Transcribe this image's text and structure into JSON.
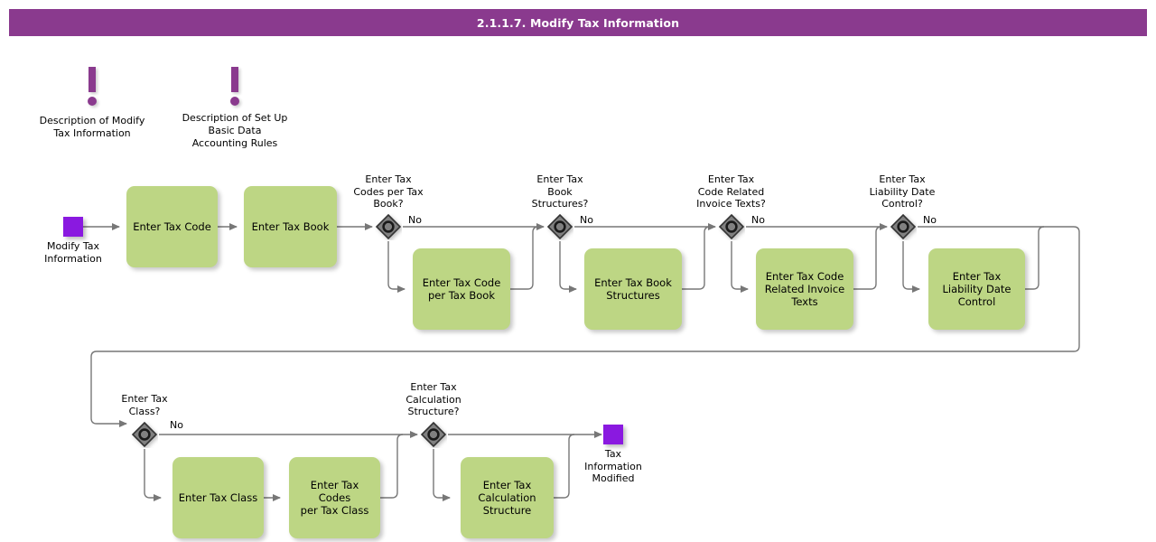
{
  "header": {
    "title": "2.1.1.7. Modify Tax Information",
    "background": "#8A3A8E",
    "text_color": "#FFFFFF"
  },
  "theme": {
    "task_fill": "#BDD684",
    "event_fill": "#8A19E0",
    "gateway_fill": "#808080",
    "gateway_stroke": "#333333",
    "connector_stroke": "#777777",
    "annotation_color": "#8A3A8E"
  },
  "annotations": [
    {
      "id": "annot-modify-tax-information",
      "icon": "exclamation-icon",
      "label": "Description of Modify\nTax Information"
    },
    {
      "id": "annot-basic-data-accounting-rules",
      "icon": "exclamation-icon",
      "label": "Description of Set Up\nBasic Data\nAccounting Rules"
    }
  ],
  "events": [
    {
      "id": "start-modify-tax-information",
      "type": "start",
      "label": "Modify Tax\nInformation"
    },
    {
      "id": "end-tax-information-modified",
      "type": "end",
      "label": "Tax\nInformation\nModified"
    }
  ],
  "gateways": [
    {
      "id": "gw-tax-codes-per-tax-book",
      "label": "Enter Tax\nCodes per Tax\nBook?",
      "flow_label": "No"
    },
    {
      "id": "gw-tax-book-structures",
      "label": "Enter Tax\nBook\nStructures?",
      "flow_label": "No"
    },
    {
      "id": "gw-tax-code-related-invoice-texts",
      "label": "Enter Tax\nCode Related\nInvoice Texts?",
      "flow_label": "No"
    },
    {
      "id": "gw-tax-liability-date-control",
      "label": "Enter Tax\nLiability Date\nControl?",
      "flow_label": "No"
    },
    {
      "id": "gw-tax-class",
      "label": "Enter Tax\nClass?",
      "flow_label": "No"
    },
    {
      "id": "gw-tax-calculation-structure",
      "label": "Enter Tax\nCalculation\nStructure?",
      "flow_label": ""
    }
  ],
  "tasks": [
    {
      "id": "task-enter-tax-code",
      "label": "Enter Tax Code"
    },
    {
      "id": "task-enter-tax-book",
      "label": "Enter Tax Book"
    },
    {
      "id": "task-enter-tax-code-per-tax-book",
      "label": "Enter Tax Code\nper Tax Book"
    },
    {
      "id": "task-enter-tax-book-structures",
      "label": "Enter Tax Book\nStructures"
    },
    {
      "id": "task-enter-tax-code-related-invoice-texts",
      "label": "Enter Tax Code\nRelated Invoice\nTexts"
    },
    {
      "id": "task-enter-tax-liability-date-control",
      "label": "Enter Tax\nLiability Date\nControl"
    },
    {
      "id": "task-enter-tax-class",
      "label": "Enter Tax Class"
    },
    {
      "id": "task-enter-tax-codes-per-tax-class",
      "label": "Enter Tax Codes\nper Tax Class"
    },
    {
      "id": "task-enter-tax-calculation-structure",
      "label": "Enter Tax\nCalculation\nStructure"
    }
  ]
}
